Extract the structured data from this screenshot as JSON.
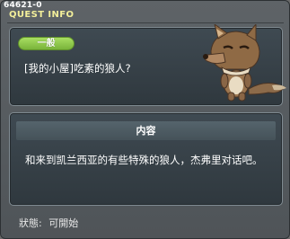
{
  "window": {
    "quest_id": "64621-0",
    "title": "QUEST INFO"
  },
  "quest": {
    "badge": "一般",
    "name": "[我的小屋]吃素的狼人?"
  },
  "content": {
    "header": "内容",
    "description": "和来到凯兰西亚的有些特殊的狼人，杰弗里对话吧。"
  },
  "status": {
    "label": "狀態:",
    "value": "可開始"
  },
  "colors": {
    "title": "#f2ee9a",
    "badge": "#8cc84b",
    "panel": "#364249"
  }
}
